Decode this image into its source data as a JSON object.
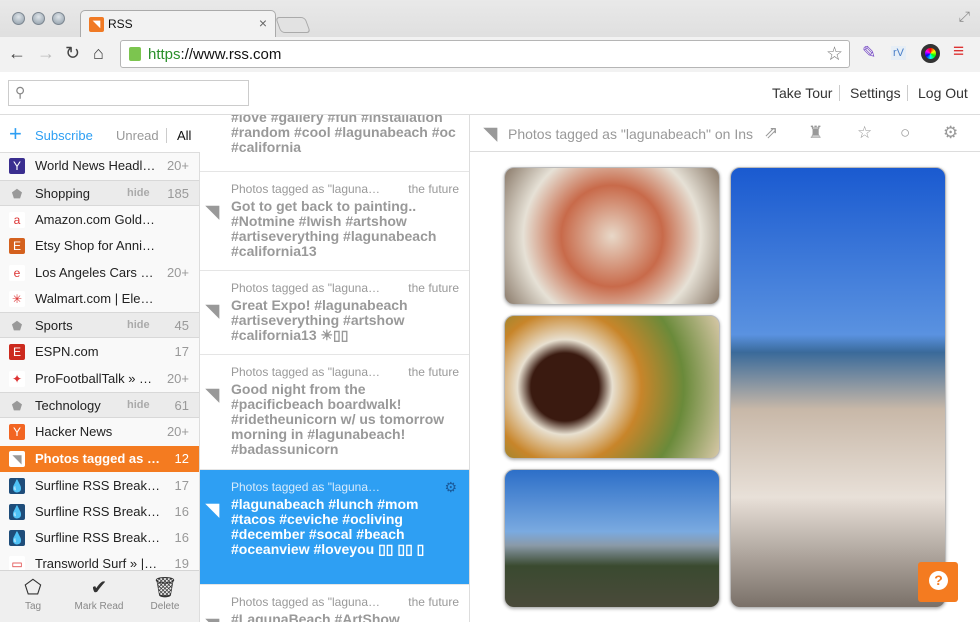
{
  "browser": {
    "tab_title": "RSS",
    "url_scheme": "https",
    "url_rest": "://www.rss.com"
  },
  "header": {
    "search_placeholder": "",
    "links": [
      "Take Tour",
      "Settings",
      "Log Out"
    ]
  },
  "sidebar": {
    "subscribe": "Subscribe",
    "filter_unread": "Unread",
    "filter_all": "All",
    "rows": [
      {
        "type": "feed",
        "label": "World News Headl…",
        "count": "20+",
        "icon": "Y",
        "color": "#3a2e8f"
      },
      {
        "type": "group",
        "label": "Shopping",
        "hide": "hide",
        "count": "185"
      },
      {
        "type": "feed",
        "label": "Amazon.com Gold…",
        "count": "",
        "icon": "a",
        "color": "#fff"
      },
      {
        "type": "feed",
        "label": "Etsy Shop for Anni…",
        "count": "",
        "icon": "E",
        "color": "#d4611e"
      },
      {
        "type": "feed",
        "label": "Los Angeles Cars …",
        "count": "20+",
        "icon": "e",
        "color": "#fff"
      },
      {
        "type": "feed",
        "label": "Walmart.com | Ele…",
        "count": "",
        "icon": "✳",
        "color": "#fff"
      },
      {
        "type": "group",
        "label": "Sports",
        "hide": "hide",
        "count": "45"
      },
      {
        "type": "feed",
        "label": "ESPN.com",
        "count": "17",
        "icon": "E",
        "color": "#cc2a1e"
      },
      {
        "type": "feed",
        "label": "ProFootballTalk » …",
        "count": "20+",
        "icon": "✦",
        "color": "#fff"
      },
      {
        "type": "group",
        "label": "Technology",
        "hide": "hide",
        "count": "61"
      },
      {
        "type": "feed",
        "label": "Hacker News",
        "count": "20+",
        "icon": "Y",
        "color": "#f26522"
      },
      {
        "type": "feed",
        "label": "Photos tagged as …",
        "count": "12",
        "icon": "◥",
        "color": "#fff",
        "selected": true
      },
      {
        "type": "feed",
        "label": "Surfline RSS Break…",
        "count": "17",
        "icon": "💧",
        "color": "#1f4d7a"
      },
      {
        "type": "feed",
        "label": "Surfline RSS Break…",
        "count": "16",
        "icon": "💧",
        "color": "#1f4d7a"
      },
      {
        "type": "feed",
        "label": "Surfline RSS Break…",
        "count": "16",
        "icon": "💧",
        "color": "#1f4d7a"
      },
      {
        "type": "feed",
        "label": "Transworld Surf » |…",
        "count": "19",
        "icon": "▭",
        "color": "#fff"
      }
    ],
    "actions": [
      "Tag",
      "Mark Read",
      "Delete"
    ]
  },
  "articles": [
    {
      "source": "",
      "when": "",
      "title": "#love #gallery #fun #installation #random #cool #lagunabeach #oc #california"
    },
    {
      "source": "Photos tagged as \"laguna…",
      "when": "the future",
      "title": "Got to get back to painting.. #Notmine #Iwish #artshow #artiseverything #lagunabeach #california13"
    },
    {
      "source": "Photos tagged as \"laguna…",
      "when": "the future",
      "title": "Great Expo! #lagunabeach #artiseverything #artshow #california13 ☀▯▯"
    },
    {
      "source": "Photos tagged as \"laguna…",
      "when": "the future",
      "title": "Good night from the #pacificbeach boardwalk! #ridetheunicorn w/ us tomorrow morning in #lagunabeach! #badassunicorn"
    },
    {
      "source": "Photos tagged as \"laguna…",
      "when": "",
      "title": "#lagunabeach #lunch #mom #tacos #ceviche #ocliving #december #socal #beach #oceanview #loveyou ▯▯       ▯▯    ▯",
      "active": true
    },
    {
      "source": "Photos tagged as \"laguna…",
      "when": "the future",
      "title": "#LagunaBeach #ArtShow"
    }
  ],
  "content": {
    "title": "Photos tagged as \"lagunabeach\" on Instagram",
    "help": "?"
  }
}
